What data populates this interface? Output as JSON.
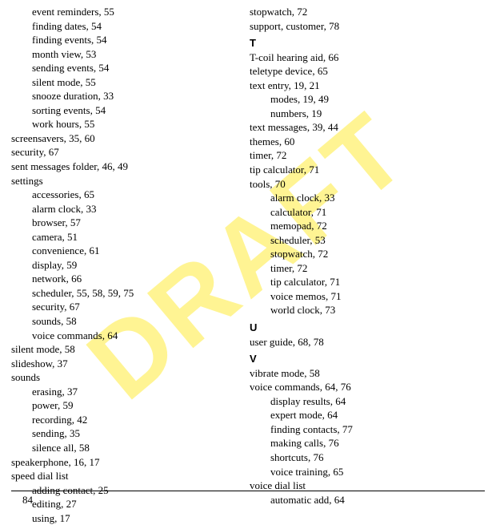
{
  "watermark": "DRAFT",
  "page_number": "84",
  "left_column": [
    {
      "text": "event reminders, 55",
      "sub": true
    },
    {
      "text": "finding dates, 54",
      "sub": true
    },
    {
      "text": "finding events, 54",
      "sub": true
    },
    {
      "text": "month view, 53",
      "sub": true
    },
    {
      "text": "sending events, 54",
      "sub": true
    },
    {
      "text": "silent mode, 55",
      "sub": true
    },
    {
      "text": "snooze duration, 33",
      "sub": true
    },
    {
      "text": "sorting events, 54",
      "sub": true
    },
    {
      "text": "work hours, 55",
      "sub": true
    },
    {
      "text": "screensavers, 35, 60",
      "sub": false
    },
    {
      "text": "security, 67",
      "sub": false
    },
    {
      "text": "sent messages folder, 46, 49",
      "sub": false
    },
    {
      "text": "settings",
      "sub": false
    },
    {
      "text": "accessories, 65",
      "sub": true
    },
    {
      "text": "alarm clock, 33",
      "sub": true
    },
    {
      "text": "browser, 57",
      "sub": true
    },
    {
      "text": "camera, 51",
      "sub": true
    },
    {
      "text": "convenience, 61",
      "sub": true
    },
    {
      "text": "display, 59",
      "sub": true
    },
    {
      "text": "network, 66",
      "sub": true
    },
    {
      "text": "scheduler, 55, 58, 59, 75",
      "sub": true
    },
    {
      "text": "security, 67",
      "sub": true
    },
    {
      "text": "sounds, 58",
      "sub": true
    },
    {
      "text": "voice commands, 64",
      "sub": true
    },
    {
      "text": "silent mode, 58",
      "sub": false
    },
    {
      "text": "slideshow, 37",
      "sub": false
    },
    {
      "text": "sounds",
      "sub": false
    },
    {
      "text": "erasing, 37",
      "sub": true
    },
    {
      "text": "power, 59",
      "sub": true
    },
    {
      "text": "recording, 42",
      "sub": true
    },
    {
      "text": "sending, 35",
      "sub": true
    },
    {
      "text": "silence all, 58",
      "sub": true
    },
    {
      "text": "speakerphone, 16, 17",
      "sub": false
    },
    {
      "text": "speed dial list",
      "sub": false
    },
    {
      "text": "adding contact, 25",
      "sub": true
    },
    {
      "text": "editing, 27",
      "sub": true
    },
    {
      "text": "using, 17",
      "sub": true
    }
  ],
  "right_column": [
    {
      "text": "stopwatch, 72",
      "sub": false
    },
    {
      "text": "support, customer, 78",
      "sub": false
    },
    {
      "text": "T",
      "letter": true
    },
    {
      "text": "T-coil hearing aid, 66",
      "sub": false
    },
    {
      "text": "teletype device, 65",
      "sub": false
    },
    {
      "text": "text entry, 19, 21",
      "sub": false
    },
    {
      "text": "modes, 19, 49",
      "sub": true
    },
    {
      "text": "numbers, 19",
      "sub": true
    },
    {
      "text": "text messages, 39, 44",
      "sub": false
    },
    {
      "text": "themes, 60",
      "sub": false
    },
    {
      "text": "timer, 72",
      "sub": false
    },
    {
      "text": "tip calculator, 71",
      "sub": false
    },
    {
      "text": "tools, 70",
      "sub": false
    },
    {
      "text": "alarm clock, 33",
      "sub": true
    },
    {
      "text": "calculator, 71",
      "sub": true
    },
    {
      "text": "memopad, 72",
      "sub": true
    },
    {
      "text": "scheduler, 53",
      "sub": true
    },
    {
      "text": "stopwatch, 72",
      "sub": true
    },
    {
      "text": "timer, 72",
      "sub": true
    },
    {
      "text": "tip calculator, 71",
      "sub": true
    },
    {
      "text": "voice memos, 71",
      "sub": true
    },
    {
      "text": "world clock, 73",
      "sub": true
    },
    {
      "text": "U",
      "letter": true
    },
    {
      "text": "user guide, 68, 78",
      "sub": false
    },
    {
      "text": "V",
      "letter": true
    },
    {
      "text": "vibrate mode, 58",
      "sub": false
    },
    {
      "text": "voice commands, 64, 76",
      "sub": false
    },
    {
      "text": "display results, 64",
      "sub": true
    },
    {
      "text": "expert mode, 64",
      "sub": true
    },
    {
      "text": "finding contacts, 77",
      "sub": true
    },
    {
      "text": "making calls, 76",
      "sub": true
    },
    {
      "text": "shortcuts, 76",
      "sub": true
    },
    {
      "text": "voice training, 65",
      "sub": true
    },
    {
      "text": "voice dial list",
      "sub": false
    },
    {
      "text": "automatic add, 64",
      "sub": true
    }
  ]
}
